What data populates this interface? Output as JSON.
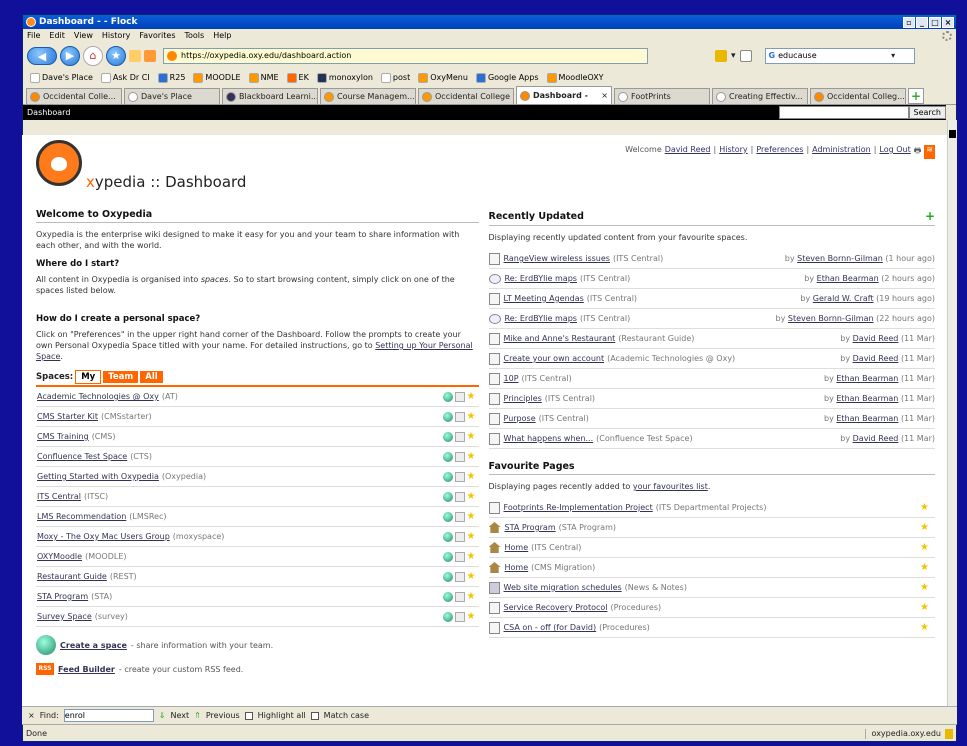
{
  "window": {
    "title": "Dashboard - - Flock"
  },
  "menu": [
    "File",
    "Edit",
    "View",
    "History",
    "Favorites",
    "Tools",
    "Help"
  ],
  "address": {
    "url": "https://oxypedia.oxy.edu/dashboard.action"
  },
  "search": {
    "engine_value": "educause"
  },
  "bookmarks": [
    "Dave's Place",
    "Ask Dr CI",
    "R25",
    "MOODLE",
    "NME",
    "EK",
    "monoxylon",
    "post",
    "OxyMenu",
    "Google Apps",
    "MoodleOXY"
  ],
  "tabs": [
    {
      "label": "Occidental Colle...",
      "active": false
    },
    {
      "label": "Dave's Place",
      "active": false
    },
    {
      "label": "Blackboard Learni...",
      "active": false
    },
    {
      "label": "Course Managem...",
      "active": false
    },
    {
      "label": "Occidental College",
      "active": false
    },
    {
      "label": "Dashboard -",
      "active": true
    },
    {
      "label": "FootPrints",
      "active": false
    },
    {
      "label": "Creating Effectiv...",
      "active": false
    },
    {
      "label": "Occidental Colleg...",
      "active": false
    }
  ],
  "wiki_bar": {
    "title": "Dashboard",
    "search_button": "Search"
  },
  "toplinks": {
    "welcome": "Welcome",
    "user": "David Reed",
    "history": "History",
    "preferences": "Preferences",
    "admin": "Administration",
    "logout": "Log Out"
  },
  "brand": {
    "name_prefix": "x",
    "name_suffix": "ypedia",
    "separator": "::",
    "page": "Dashboard"
  },
  "welcome": {
    "heading": "Welcome to Oxypedia",
    "intro": "Oxypedia is the enterprise wiki designed to make it easy for you and your team to share information with each other, and with the world.",
    "start_heading": "Where do I start?",
    "start_text_1": "All content in Oxypedia is organised into ",
    "start_text_em": "spaces",
    "start_text_2": ". So to start browsing content, simply click on one of the spaces listed below.",
    "personal_heading": "How do I create a personal space?",
    "personal_text": "Click on \"Preferences\" in the upper right hand corner of the Dashboard. Follow the prompts to create your own Personal Oxypedia Space titled with your name. For detailed instructions, go to ",
    "personal_link": "Setting up Your Personal Space",
    "personal_end": "."
  },
  "spaces": {
    "label": "Spaces:",
    "tabs": [
      "My",
      "Team",
      "All"
    ],
    "items": [
      {
        "name": "Academic Technologies @ Oxy",
        "key": "(AT)"
      },
      {
        "name": "CMS Starter Kit",
        "key": "(CMSstarter)"
      },
      {
        "name": "CMS Training",
        "key": "(CMS)"
      },
      {
        "name": "Confluence Test Space",
        "key": "(CTS)"
      },
      {
        "name": "Getting Started with Oxypedia",
        "key": "(Oxypedia)"
      },
      {
        "name": "ITS Central",
        "key": "(ITSC)"
      },
      {
        "name": "LMS Recommendation",
        "key": "(LMSRec)"
      },
      {
        "name": "Moxy - The Oxy Mac Users Group",
        "key": "(moxyspace)"
      },
      {
        "name": "OXYMoodle",
        "key": "(MOODLE)"
      },
      {
        "name": "Restaurant Guide",
        "key": "(REST)"
      },
      {
        "name": "STA Program",
        "key": "(STA)"
      },
      {
        "name": "Survey Space",
        "key": "(survey)"
      }
    ],
    "create_link": "Create a space",
    "create_desc": " - share information with your team.",
    "feed_link": "Feed Builder",
    "feed_desc": " - create your custom RSS feed."
  },
  "recent": {
    "heading": "Recently Updated",
    "desc": "Displaying recently updated content from your favourite spaces.",
    "items": [
      {
        "icon": "page",
        "title": "RangeView wireless issues",
        "space": "(ITS Central)",
        "by": "by",
        "user": "Steven Bornn-Gilman",
        "when": "(1 hour ago)"
      },
      {
        "icon": "comment",
        "title": "Re: ErdBYlie maps",
        "space": "(ITS Central)",
        "by": "by",
        "user": "Ethan Bearman",
        "when": "(2 hours ago)"
      },
      {
        "icon": "page",
        "title": "LT Meeting Agendas",
        "space": "(ITS Central)",
        "by": "by",
        "user": "Gerald W. Craft",
        "when": "(19 hours ago)"
      },
      {
        "icon": "comment",
        "title": "Re: ErdBYlie maps",
        "space": "(ITS Central)",
        "by": "by",
        "user": "Steven Bornn-Gilman",
        "when": "(22 hours ago)"
      },
      {
        "icon": "page",
        "title": "Mike and Anne's Restaurant",
        "space": "(Restaurant Guide)",
        "by": "by",
        "user": "David Reed",
        "when": "(11 Mar)"
      },
      {
        "icon": "page",
        "title": "Create your own account",
        "space": "(Academic Technologies @ Oxy)",
        "by": "by",
        "user": "David Reed",
        "when": "(11 Mar)"
      },
      {
        "icon": "page",
        "title": "10P",
        "space": "(ITS Central)",
        "by": "by",
        "user": "Ethan Bearman",
        "when": "(11 Mar)"
      },
      {
        "icon": "page",
        "title": "Principles",
        "space": "(ITS Central)",
        "by": "by",
        "user": "Ethan Bearman",
        "when": "(11 Mar)"
      },
      {
        "icon": "page",
        "title": "Purpose",
        "space": "(ITS Central)",
        "by": "by",
        "user": "Ethan Bearman",
        "when": "(11 Mar)"
      },
      {
        "icon": "page",
        "title": "What happens when...",
        "space": "(Confluence Test Space)",
        "by": "by",
        "user": "David Reed",
        "when": "(11 Mar)"
      }
    ]
  },
  "favourites": {
    "heading": "Favourite Pages",
    "desc_prefix": "Displaying pages recently added to ",
    "desc_link": "your favourites list",
    "desc_suffix": ".",
    "items": [
      {
        "icon": "page",
        "title": "Footprints Re-Implementation Project",
        "space": "(ITS Departmental Projects)"
      },
      {
        "icon": "home",
        "title": "STA Program",
        "space": "(STA Program)"
      },
      {
        "icon": "home",
        "title": "Home",
        "space": "(ITS Central)"
      },
      {
        "icon": "home",
        "title": "Home",
        "space": "(CMS Migration)"
      },
      {
        "icon": "news",
        "title": "Web site migration schedules",
        "space": "(News & Notes)"
      },
      {
        "icon": "page",
        "title": "Service Recovery Protocol",
        "space": "(Procedures)"
      },
      {
        "icon": "page",
        "title": "CSA on - off (for David)",
        "space": "(Procedures)"
      }
    ]
  },
  "find": {
    "label": "Find:",
    "value": "enrol",
    "next": "Next",
    "previous": "Previous",
    "highlight": "Highlight all",
    "match": "Match case"
  },
  "status": {
    "left": "Done",
    "right": "oxypedia.oxy.edu"
  },
  "colors": {
    "accent": "#ff6600",
    "chrome": "#ece9d8",
    "titlebar": "#0a5fd8",
    "star": "#f5c400"
  }
}
